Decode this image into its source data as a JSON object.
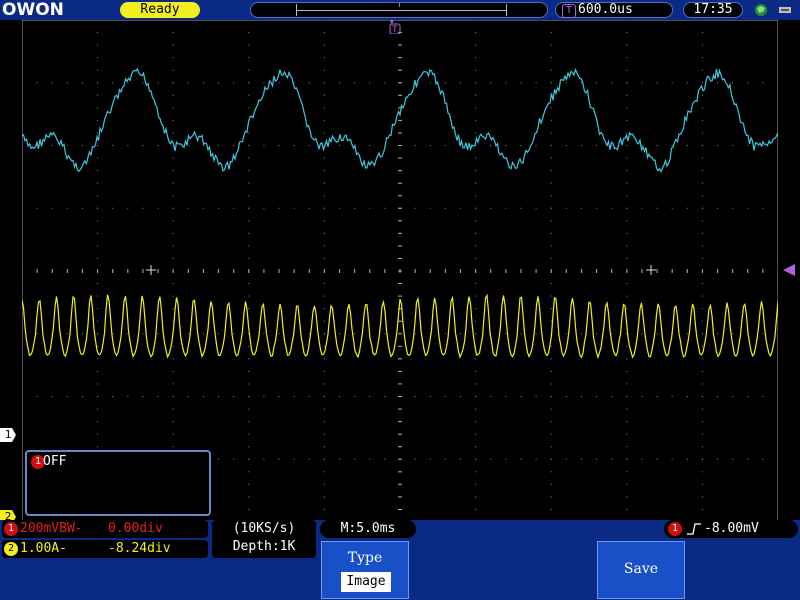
{
  "brand": "OWON",
  "status": "Ready",
  "trigger_position": "600.0us",
  "clock": "17:35",
  "channel1": {
    "marker": "1",
    "popup_text": "OFF",
    "scale": "200mVBW-",
    "offset": "0.00div",
    "color": "#e02020",
    "trace_color": "#40c8e0"
  },
  "channel2": {
    "marker": "2",
    "scale": "1.00A-",
    "offset": "-8.24div",
    "color": "#f2ef20"
  },
  "acquisition": {
    "sample_rate": "(10KS/s)",
    "depth": "Depth:1K"
  },
  "timebase": "M:5.0ms",
  "trigger": {
    "source": "1",
    "level": "-8.00mV",
    "color": "#b060e0"
  },
  "softkeys": {
    "type_label": "Type",
    "type_value": "Image",
    "save_label": "Save"
  },
  "icons": {
    "network": "network-icon",
    "usb": "usb-icon",
    "trigger_edge": "rising-edge-icon"
  }
}
